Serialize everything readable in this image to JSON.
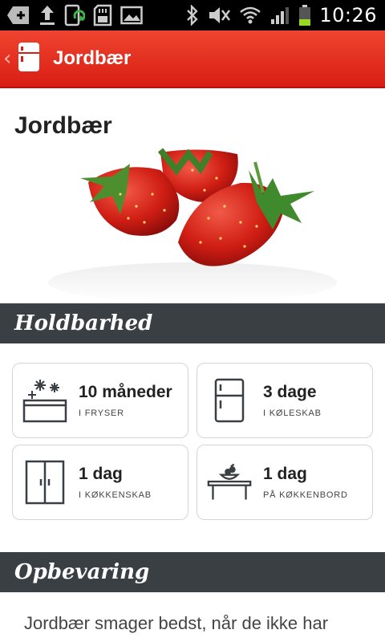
{
  "status_bar": {
    "time": "10:26",
    "icons": [
      "plus-icon",
      "upload-icon",
      "phone-sync-icon",
      "sd-card-icon",
      "image-icon",
      "bluetooth-icon",
      "mute-icon",
      "wifi-icon",
      "signal-icon",
      "battery-icon"
    ]
  },
  "action_bar": {
    "title": "Jordbær",
    "app_icon": "fridge-icon",
    "back_icon": "chevron-left-icon"
  },
  "page": {
    "title": "Jordbær",
    "image": "strawberries-photo"
  },
  "sections": {
    "holdbarhed": "Holdbarhed",
    "opbevaring": "Opbevaring"
  },
  "storage": [
    {
      "value": "10 måneder",
      "label": "I FRYSER",
      "icon": "freezer-icon"
    },
    {
      "value": "3 dage",
      "label": "I KØLESKAB",
      "icon": "fridge-icon"
    },
    {
      "value": "1 dag",
      "label": "I KØKKENSKAB",
      "icon": "cupboard-icon"
    },
    {
      "value": "1 dag",
      "label": "PÅ KØKKENBORD",
      "icon": "table-bowl-icon"
    }
  ],
  "paragraph": "Jordbær smager bedst, når de ikke har",
  "colors": {
    "action_bar": "#e0281c",
    "section_header": "#3a3f44",
    "icon_stroke": "#3a3f44"
  }
}
